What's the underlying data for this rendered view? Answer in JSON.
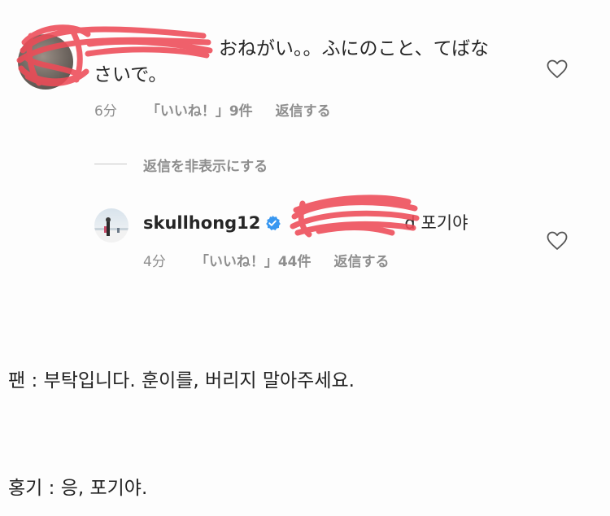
{
  "comment": {
    "username": "",
    "text_line1": "おねがい。。ふにのこと、てばな",
    "text_line2": "さいで。",
    "time": "6分",
    "likes": "「いいね！」9件",
    "reply": "返信する"
  },
  "hide_replies": "返信を非表示にする",
  "reply": {
    "username": "skullhong12",
    "mention_tail": "d",
    "text": "포기야",
    "time": "4分",
    "likes": "「いいね！」44件",
    "reply": "返信する"
  },
  "captions": [
    "팬 : 부탁입니다. 훈이를, 버리지 말아주세요.",
    "홍기 : 응, 포기야."
  ],
  "colors": {
    "scribble": "#ee4b57",
    "meta": "#8e8e8e",
    "verified": "#3897f0"
  }
}
